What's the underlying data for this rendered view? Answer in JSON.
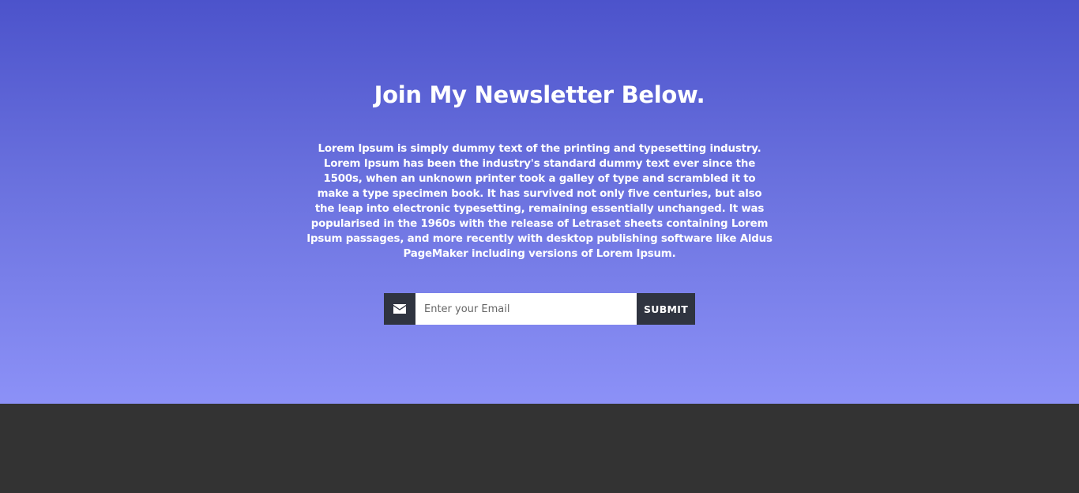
{
  "newsletter": {
    "title": "Join My Newsletter Below.",
    "body": "Lorem Ipsum is simply dummy text of the printing and typesetting industry. Lorem Ipsum has been the industry's standard dummy text ever since the 1500s, when an unknown printer took a galley of type and scrambled it to make a type specimen book. It has survived not only five centuries, but also the leap into electronic typesetting, remaining essentially unchanged. It was popularised in the 1960s with the release of Letraset sheets containing Lorem Ipsum passages, and more recently with desktop publishing software like Aldus PageMaker including versions of Lorem Ipsum.",
    "email_placeholder": "Enter your Email",
    "email_value": "",
    "submit_label": "SUBMIT",
    "mail_icon": "envelope-icon"
  },
  "colors": {
    "gradient_top": "#4c53cb",
    "gradient_bottom": "#8c91f7",
    "button_bg": "#2f3440",
    "footer_bg": "#333333",
    "text": "#ffffff"
  }
}
